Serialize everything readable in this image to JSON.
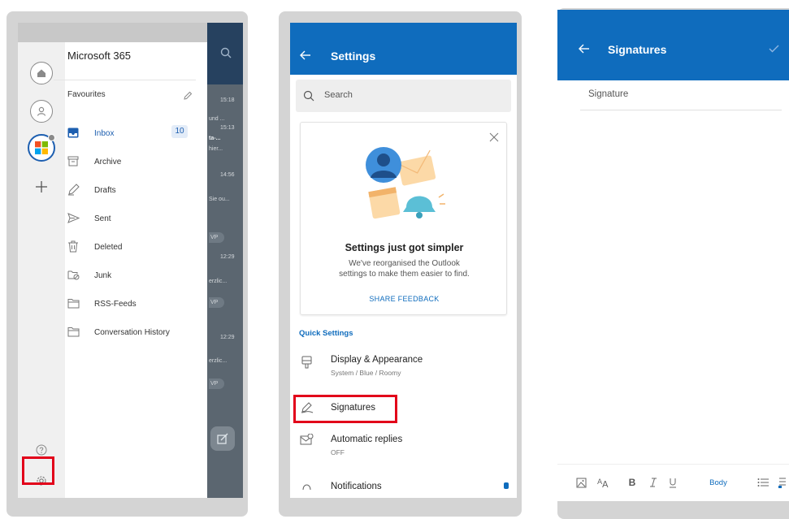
{
  "panel1": {
    "account_title": "Microsoft 365",
    "favourites_label": "Favourites",
    "folders": [
      {
        "label": "Inbox",
        "icon": "inbox-icon",
        "active": true
      },
      {
        "label": "Archive",
        "icon": "archive-icon"
      },
      {
        "label": "Drafts",
        "icon": "drafts-icon"
      },
      {
        "label": "Sent",
        "icon": "sent-icon"
      },
      {
        "label": "Deleted",
        "icon": "trash-icon"
      },
      {
        "label": "Junk",
        "icon": "junk-icon"
      },
      {
        "label": "RSS-Feeds",
        "icon": "folder-icon"
      },
      {
        "label": "Conversation History",
        "icon": "folder-icon"
      }
    ],
    "inbox_count": "10",
    "background_mail": {
      "times": [
        "15:18",
        "15:13",
        "14:56",
        "12:29",
        "12:29"
      ],
      "snippets": [
        "und ...",
        "ta-...",
        "hier...",
        "Sie ou...",
        "erzlic...",
        "erzlic..."
      ],
      "badge_vp": "VP"
    }
  },
  "panel2": {
    "title": "Settings",
    "search_placeholder": "Search",
    "card": {
      "title": "Settings just got simpler",
      "body_line1": "We've reorganised the Outlook",
      "body_line2": "settings to make them easier to find.",
      "link": "SHARE FEEDBACK"
    },
    "quick_settings_label": "Quick Settings",
    "items": [
      {
        "label": "Display & Appearance",
        "sub": "System / Blue / Roomy"
      },
      {
        "label": "Signatures",
        "sub": ""
      },
      {
        "label": "Automatic replies",
        "sub": "OFF"
      },
      {
        "label": "Notifications",
        "sub": ""
      }
    ]
  },
  "panel3": {
    "title": "Signatures",
    "field_label": "Signature",
    "toolbar": {
      "body_label": "Body",
      "bold": "B"
    }
  },
  "colors": {
    "accent_blue": "#0f6cbd",
    "highlight_red": "#e2001a",
    "dark_navy": "#26415f"
  }
}
